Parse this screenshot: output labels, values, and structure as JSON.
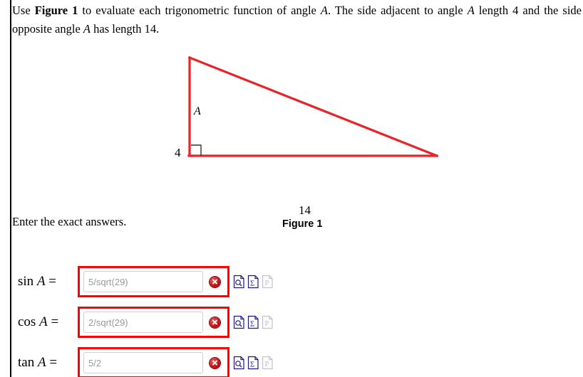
{
  "prompt": {
    "part1": "Use ",
    "figure_ref": "Figure 1",
    "part2": " to evaluate each trigonometric function of angle ",
    "var1": "A",
    "part3": ". The side adjacent to angle ",
    "var2": "A",
    "part4": " length 4 and the side opposite angle ",
    "var3": "A",
    "part5": " has length 14."
  },
  "figure": {
    "vertex_label": "A",
    "adjacent_side_label": "4",
    "opposite_side_label": "14",
    "caption": "Figure 1",
    "stroke_color": "#e8232a",
    "right_angle_color": "#333333"
  },
  "instructions": {
    "text": "Enter the exact answers."
  },
  "answers": [
    {
      "id": "sin",
      "function_name": "sin",
      "variable": "A",
      "equals": "=",
      "placeholder": "5/sqrt(29)",
      "value": "",
      "status": "incorrect",
      "status_icon": "red-x-circle-icon"
    },
    {
      "id": "cos",
      "function_name": "cos",
      "variable": "A",
      "equals": "=",
      "placeholder": "2/sqrt(29)",
      "value": "",
      "status": "incorrect",
      "status_icon": "red-x-circle-icon"
    },
    {
      "id": "tan",
      "function_name": "tan",
      "variable": "A",
      "equals": "=",
      "placeholder": "5/2",
      "value": "",
      "status": "incorrect",
      "status_icon": "red-x-circle-icon"
    }
  ],
  "tool_icons": [
    {
      "name": "preview-magnifier-icon",
      "glyph": "magnifier",
      "enabled": true
    },
    {
      "name": "math-palette-sigma-icon",
      "glyph": "sigma",
      "enabled": true
    },
    {
      "name": "print-page-icon",
      "glyph": "P",
      "enabled": false
    }
  ],
  "colors": {
    "validation_border": "#ff0000",
    "status_red": "#cc1111",
    "figure_red": "#e8232a",
    "placeholder_grey": "#9a9a9a"
  }
}
